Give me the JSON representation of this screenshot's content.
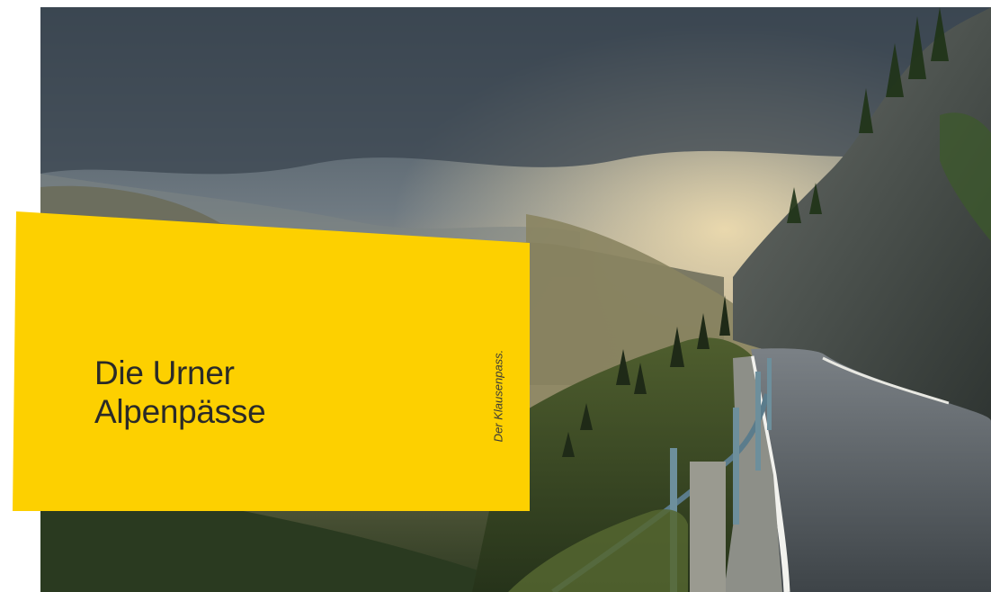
{
  "banner": {
    "title_line1": "Die Urner",
    "title_line2": "Alpenpässe",
    "caption": "Der Klausenpass.",
    "color": "#FDD000"
  },
  "photo": {
    "subject": "mountain-pass-road-at-sunset"
  }
}
